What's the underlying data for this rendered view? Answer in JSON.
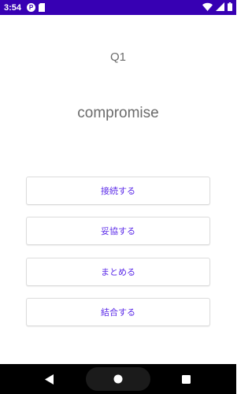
{
  "status_bar": {
    "time": "3:54",
    "notification_letter": "P",
    "icons": [
      "notification-p-icon",
      "sd-card-icon",
      "wifi-icon",
      "signal-icon",
      "battery-icon"
    ],
    "background_color": "#3700b3"
  },
  "quiz": {
    "question_label": "Q1",
    "word": "compromise",
    "choices": [
      {
        "label": "接続する"
      },
      {
        "label": "妥協する"
      },
      {
        "label": "まとめる"
      },
      {
        "label": "結合する"
      }
    ],
    "choice_text_color": "#5b2ae8"
  },
  "nav_bar": {
    "icons": [
      "back-icon",
      "home-icon",
      "recents-icon"
    ]
  }
}
